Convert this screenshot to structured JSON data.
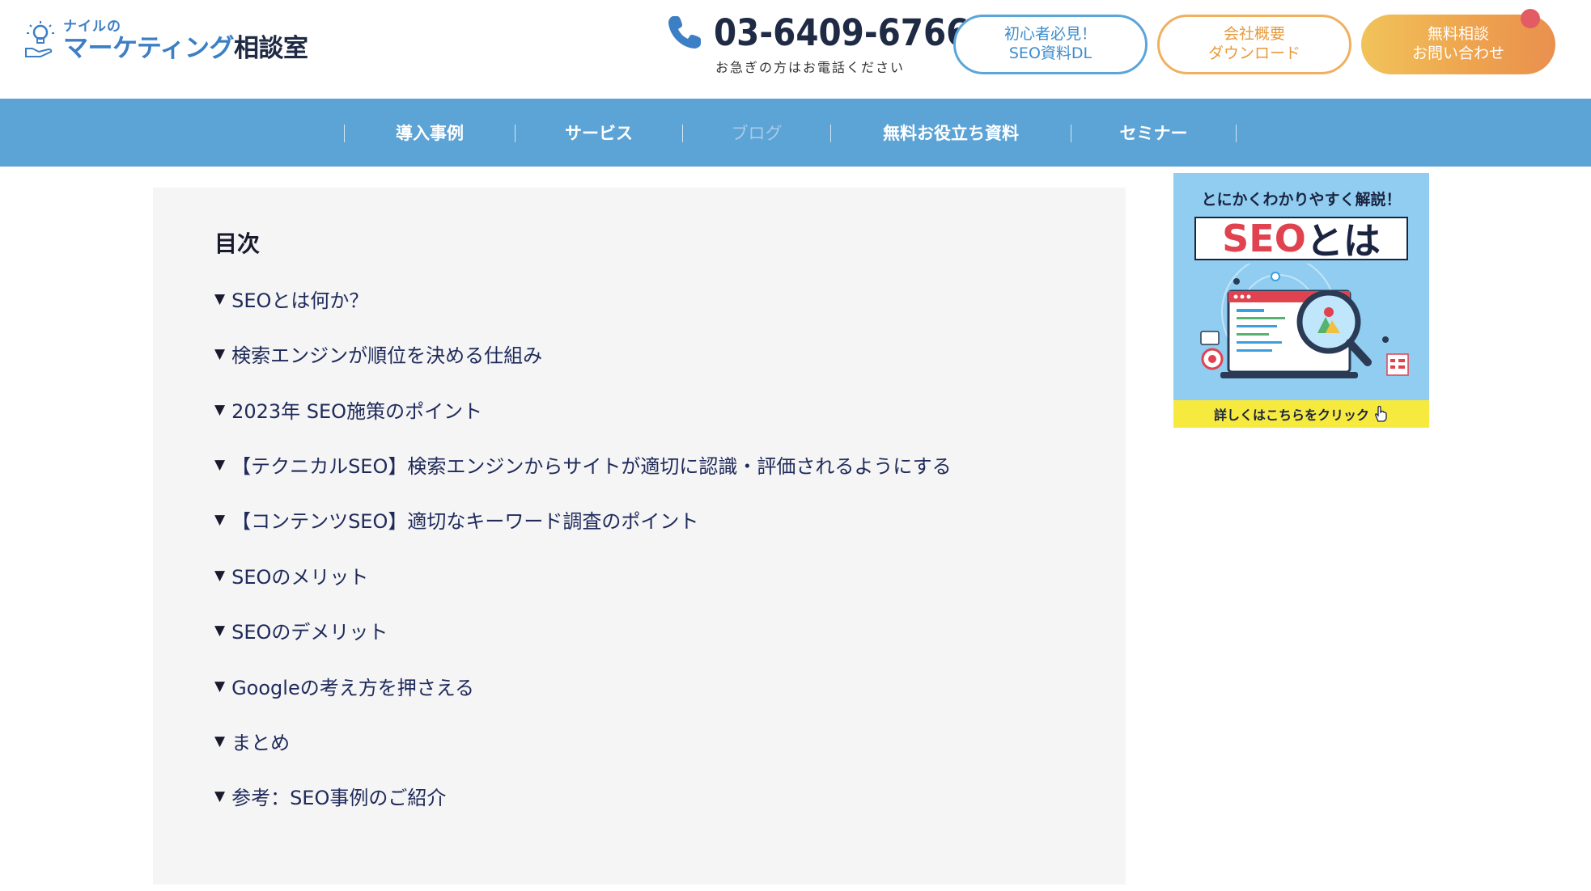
{
  "header": {
    "logo": {
      "top": "ナイルの",
      "bottom_blue": "マーケティング",
      "bottom_dark": "相談室"
    },
    "phone": {
      "number": "03-6409-6766",
      "note": "お急ぎの方はお電話ください"
    },
    "buttons": {
      "seo_dl": {
        "line1": "初心者必見！",
        "line2": "SEO資料DL"
      },
      "company": {
        "line1": "会社概要",
        "line2": "ダウンロード"
      },
      "contact": {
        "line1": "無料相談",
        "line2": "お問い合わせ"
      }
    }
  },
  "nav": {
    "items": [
      {
        "label": "導入事例"
      },
      {
        "label": "サービス"
      },
      {
        "label": "ブログ",
        "active": true
      },
      {
        "label": "無料お役立ち資料"
      },
      {
        "label": "セミナー"
      }
    ]
  },
  "toc": {
    "title": "目次",
    "items": [
      "SEOとは何か？",
      "検索エンジンが順位を決める仕組み",
      "2023年 SEO施策のポイント",
      "【テクニカルSEO】検索エンジンからサイトが適切に認識・評価されるようにする",
      "【コンテンツSEO】適切なキーワード調査のポイント",
      "SEOのメリット",
      "SEOのデメリット",
      "Googleの考え方を押さえる",
      "まとめ",
      "参考：SEO事例のご紹介"
    ]
  },
  "banner": {
    "top": "とにかくわかりやすく解説！",
    "seo": "SEO",
    "toha": "とは",
    "cta": "詳しくはこちらをクリック"
  },
  "colors": {
    "nav_bg": "#5ca3d6",
    "toc_bg": "#f5f5f5",
    "seo_red": "#e0434f",
    "cta_yellow": "#f7ea3f"
  }
}
